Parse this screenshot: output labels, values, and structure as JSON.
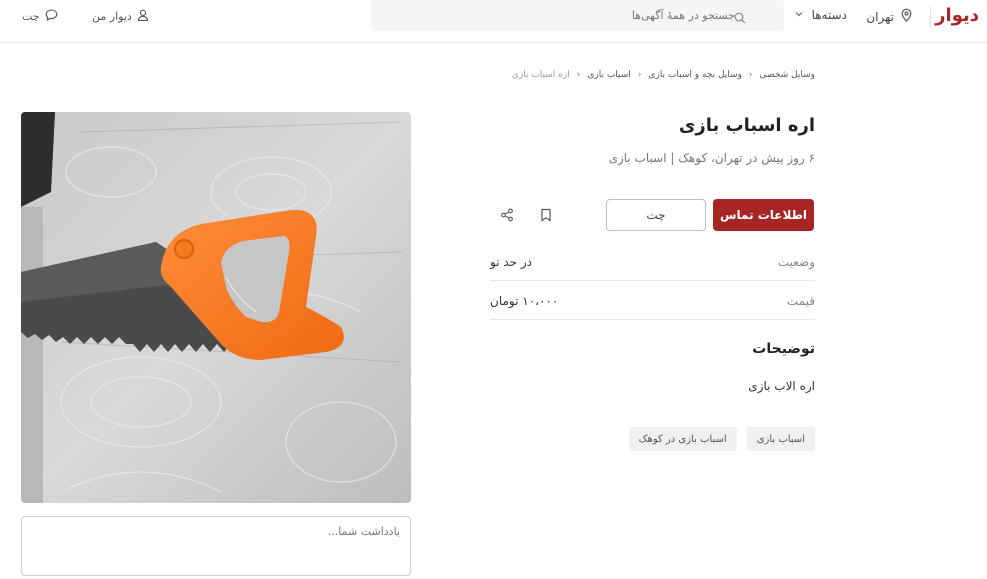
{
  "header": {
    "logo": "دیوار",
    "city": "تهران",
    "categories": "دسته‌ها",
    "search_placeholder": "جستجو در همهٔ آگهی‌ها",
    "my_divar": "دیوار من",
    "chat": "چت"
  },
  "breadcrumb": [
    "وسایل شخصی",
    "وسایل بچه و اسباب بازی",
    "اسباب بازی",
    "اره اسباب بازی"
  ],
  "ad": {
    "title": "اره اسباب بازی",
    "subtitle": "۶ روز پیش در تهران، کوهک | اسباب بازی",
    "contact_button": "اطلاعات تماس",
    "chat_button": "چت",
    "details": [
      {
        "key": "وضعیت",
        "value": "در حد نو"
      },
      {
        "key": "قیمت",
        "value": "۱۰،۰۰۰ تومان"
      }
    ],
    "description_heading": "توضیحات",
    "description": "اره الاب بازی",
    "tags": [
      "اسباب بازی",
      "اسباب بازی در کوهک"
    ],
    "note_placeholder": "یادداشت شما..."
  },
  "colors": {
    "brand": "#a62626"
  },
  "icons": [
    "location-icon",
    "chevron-down-icon",
    "search-icon",
    "user-icon",
    "chat-icon",
    "bookmark-icon",
    "share-icon"
  ]
}
